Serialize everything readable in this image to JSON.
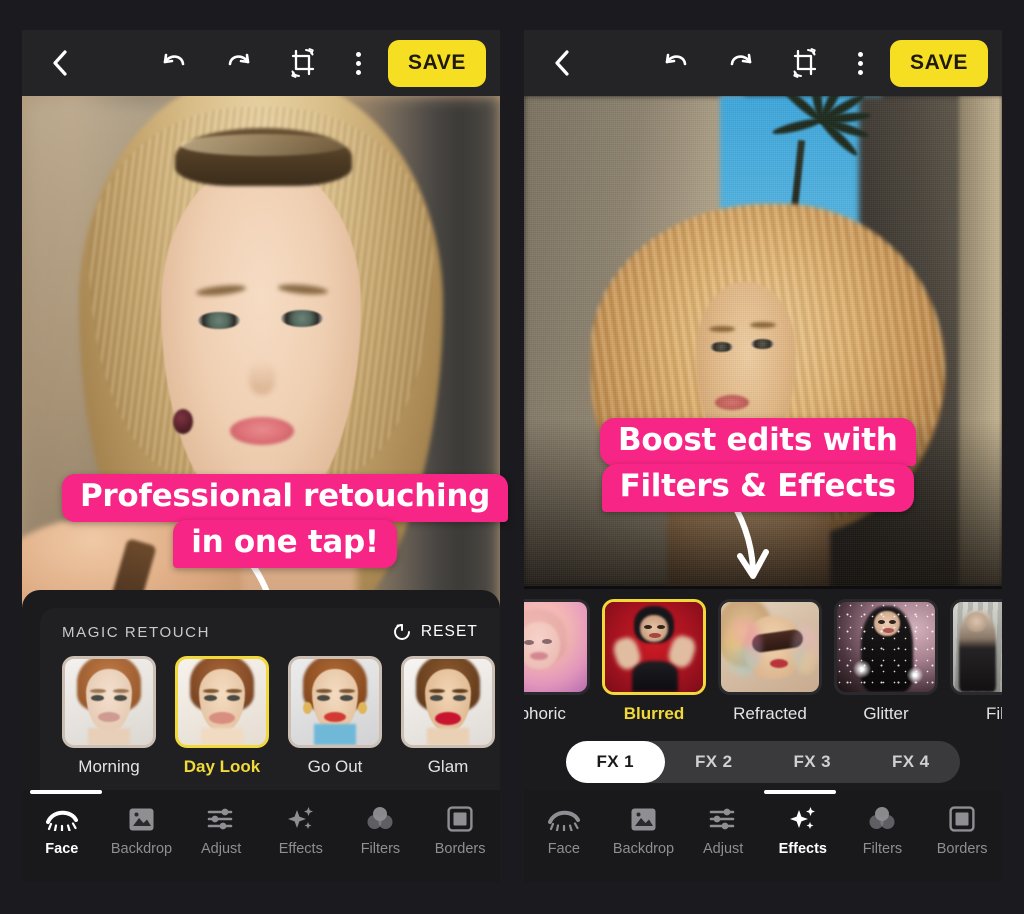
{
  "app": {
    "background_color": "#1a1a1f",
    "accent_yellow": "#f6df22",
    "accent_pink": "#f72585"
  },
  "toolbar": {
    "back_icon": "chevron-left-icon",
    "undo_icon": "undo-arrow-icon",
    "redo_icon": "redo-arrow-icon",
    "crop_icon": "crop-rotate-icon",
    "more_icon": "overflow-menu-icon",
    "save_label": "SAVE"
  },
  "left_screen": {
    "callout": {
      "line1": "Professional retouching",
      "line2": "in one tap!"
    },
    "panel": {
      "title": "MAGIC RETOUCH",
      "reset_label": "RESET",
      "reset_icon": "reset-circular-arrow-icon",
      "presets": [
        {
          "label": "Morning",
          "active": false
        },
        {
          "label": "Day Look",
          "active": true
        },
        {
          "label": "Go Out",
          "active": false
        },
        {
          "label": "Glam",
          "active": false
        }
      ]
    },
    "tools": [
      {
        "label": "Face",
        "icon": "eye-lash-icon",
        "active": true
      },
      {
        "label": "Backdrop",
        "icon": "image-mountain-icon",
        "active": false
      },
      {
        "label": "Adjust",
        "icon": "sliders-icon",
        "active": false
      },
      {
        "label": "Effects",
        "icon": "sparkles-icon",
        "active": false
      },
      {
        "label": "Filters",
        "icon": "three-circles-icon",
        "active": false
      },
      {
        "label": "Borders",
        "icon": "square-frame-icon",
        "active": false
      }
    ]
  },
  "right_screen": {
    "callout": {
      "line1": "Boost edits with",
      "line2": "Filters & Effects"
    },
    "effects": [
      {
        "label": "uphoric",
        "active": false
      },
      {
        "label": "Blurred",
        "active": true
      },
      {
        "label": "Refracted",
        "active": false
      },
      {
        "label": "Glitter",
        "active": false
      },
      {
        "label": "Film",
        "active": false
      }
    ],
    "fx_tabs": [
      {
        "label": "FX 1",
        "active": true
      },
      {
        "label": "FX 2",
        "active": false
      },
      {
        "label": "FX 3",
        "active": false
      },
      {
        "label": "FX 4",
        "active": false
      }
    ],
    "tools": [
      {
        "label": "Face",
        "icon": "eye-lash-icon",
        "active": false
      },
      {
        "label": "Backdrop",
        "icon": "image-mountain-icon",
        "active": false
      },
      {
        "label": "Adjust",
        "icon": "sliders-icon",
        "active": false
      },
      {
        "label": "Effects",
        "icon": "sparkles-icon",
        "active": true
      },
      {
        "label": "Filters",
        "icon": "three-circles-icon",
        "active": false
      },
      {
        "label": "Borders",
        "icon": "square-frame-icon",
        "active": false
      }
    ]
  }
}
